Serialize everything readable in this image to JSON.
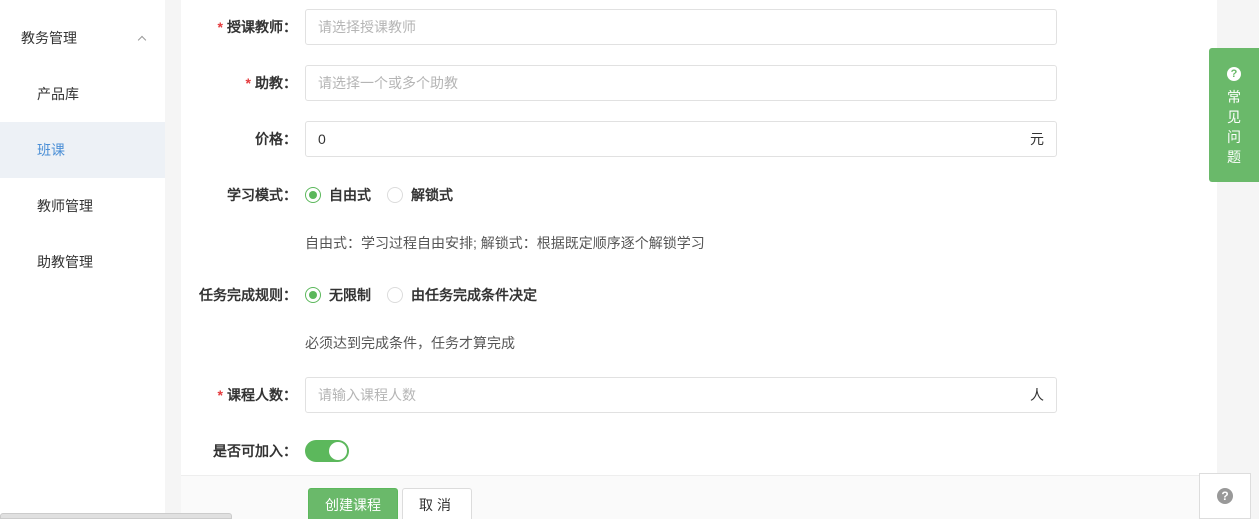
{
  "sidebar": {
    "group_label": "教务管理",
    "items": [
      {
        "label": "产品库"
      },
      {
        "label": "班课"
      },
      {
        "label": "教师管理"
      },
      {
        "label": "助教管理"
      }
    ]
  },
  "form": {
    "teacher": {
      "label": "授课教师：",
      "placeholder": "请选择授课教师"
    },
    "assistant": {
      "label": "助教：",
      "placeholder": "请选择一个或多个助教"
    },
    "price": {
      "label": "价格：",
      "value": "0",
      "suffix": "元"
    },
    "study_mode": {
      "label": "学习模式：",
      "options": [
        "自由式",
        "解锁式"
      ],
      "selected": "自由式",
      "help": "自由式：学习过程自由安排; 解锁式：根据既定顺序逐个解锁学习"
    },
    "task_rule": {
      "label": "任务完成规则：",
      "options": [
        "无限制",
        "由任务完成条件决定"
      ],
      "selected": "无限制",
      "help": "必须达到完成条件，任务才算完成"
    },
    "capacity": {
      "label": "课程人数：",
      "placeholder": "请输入课程人数",
      "suffix": "人"
    },
    "joinable": {
      "label": "是否可加入：",
      "on": true
    }
  },
  "footer": {
    "create_label": "创建课程",
    "cancel_label": "取消"
  },
  "faq": {
    "chars": [
      "常",
      "见",
      "问",
      "题"
    ]
  },
  "required_mark": "*",
  "colors": {
    "accent": "#6ab96a",
    "active_nav": "#4b8fd6",
    "required": "#e4393c"
  }
}
